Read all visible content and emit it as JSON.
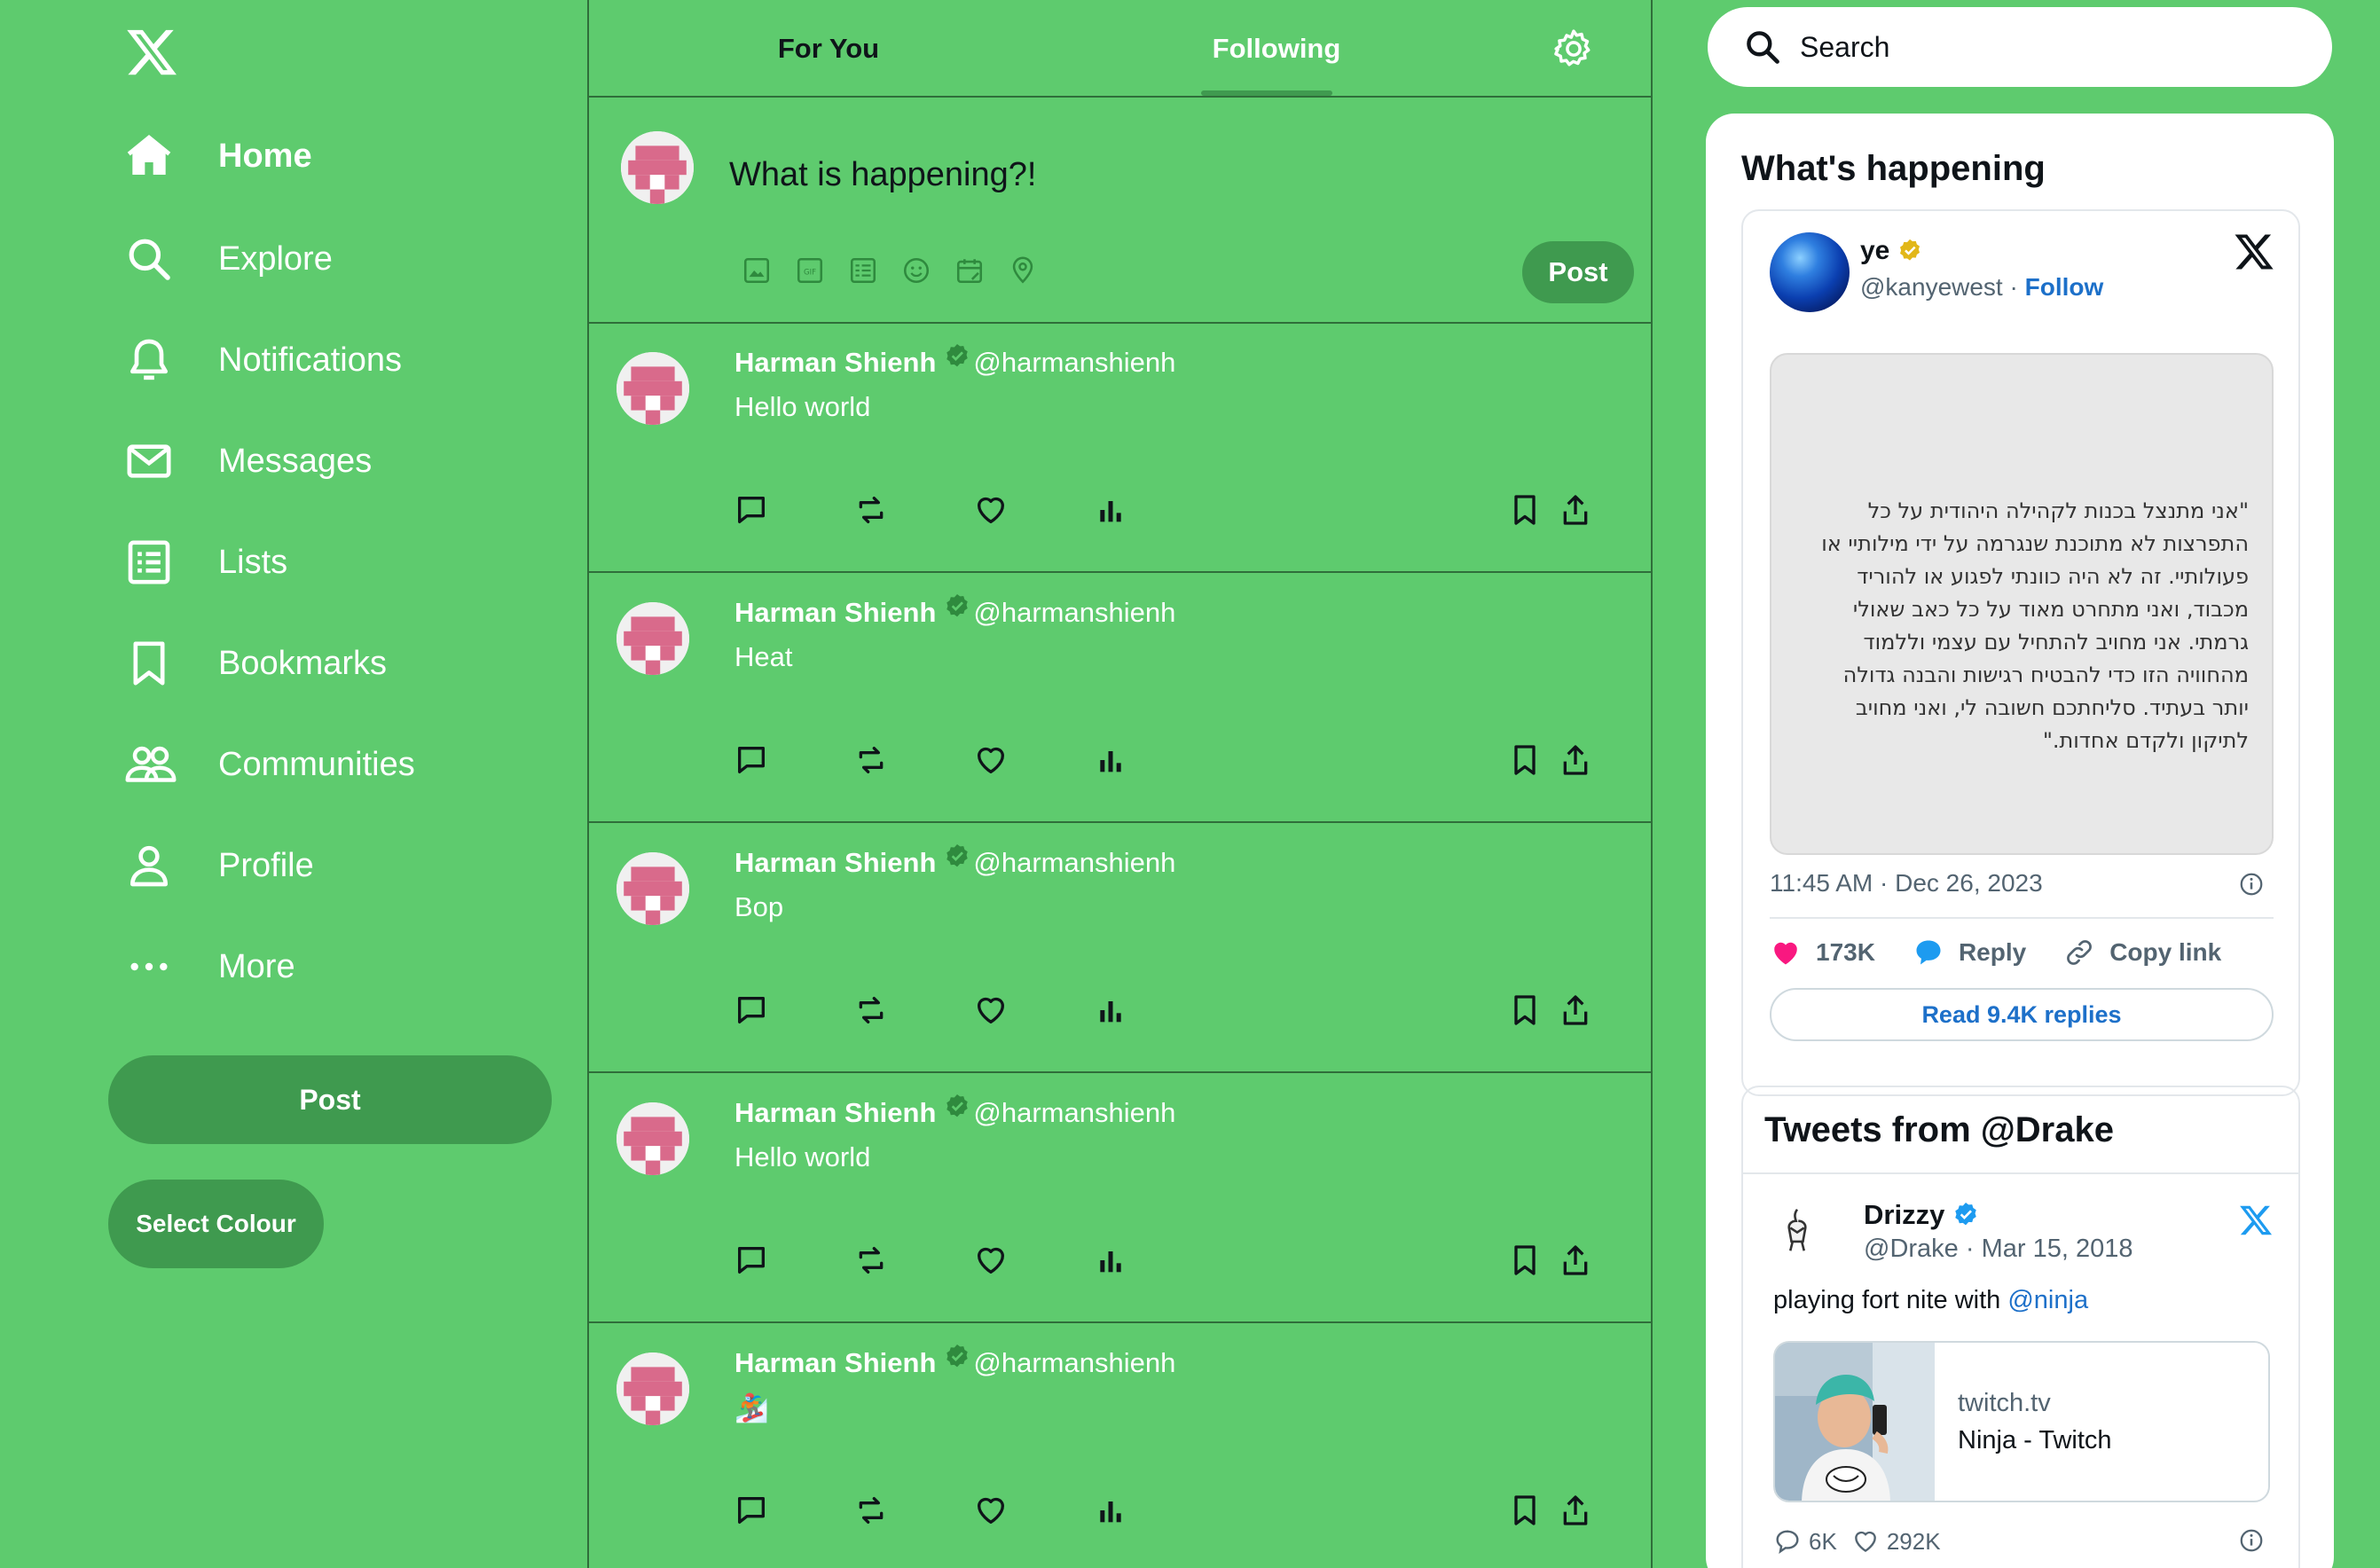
{
  "sidebar": {
    "logo": "x-logo",
    "items": [
      {
        "label": "Home",
        "icon": "home-icon",
        "active": true
      },
      {
        "label": "Explore",
        "icon": "search-icon"
      },
      {
        "label": "Notifications",
        "icon": "bell-icon"
      },
      {
        "label": "Messages",
        "icon": "envelope-icon"
      },
      {
        "label": "Lists",
        "icon": "list-icon"
      },
      {
        "label": "Bookmarks",
        "icon": "bookmark-icon"
      },
      {
        "label": "Communities",
        "icon": "people-icon"
      },
      {
        "label": "Profile",
        "icon": "person-icon"
      },
      {
        "label": "More",
        "icon": "more-icon"
      }
    ],
    "post_label": "Post",
    "select_colour_label": "Select Colour"
  },
  "tabs": [
    {
      "label": "For You",
      "active": false
    },
    {
      "label": "Following",
      "active": true
    }
  ],
  "composer": {
    "placeholder": "What is happening?!",
    "tools": [
      "image-icon",
      "gif-icon",
      "poll-icon",
      "emoji-icon",
      "schedule-icon",
      "location-icon"
    ],
    "post_label": "Post"
  },
  "tweets": [
    {
      "name": "Harman Shienh",
      "handle": "@harmanshienh",
      "text": "Hello world"
    },
    {
      "name": "Harman Shienh",
      "handle": "@harmanshienh",
      "text": "Heat"
    },
    {
      "name": "Harman Shienh",
      "handle": "@harmanshienh",
      "text": "Bop"
    },
    {
      "name": "Harman Shienh",
      "handle": "@harmanshienh",
      "text": "Hello world"
    },
    {
      "name": "Harman Shienh",
      "handle": "@harmanshienh",
      "text": "🏂"
    }
  ],
  "search": {
    "placeholder": "Search"
  },
  "whats_happening": {
    "title": "What's happening",
    "embed": {
      "name": "ye",
      "handle": "@kanyewest",
      "separator": "·",
      "follow_label": "Follow",
      "quote_text": "\"אני מתנצל בכנות לקהילה היהודית על כל התפרצות לא מתוכנת שנגרמה על ידי מילותיי או פעולותיי. זה לא היה כוונתי לפגוע או להוריד מכבוד, ואני מתחרט מאוד על כל כאב שאולי גרמתי. אני מחויב להתחיל עם עצמי וללמוד מהחוויה הזו כדי להבטיח רגישות והבנה גדולה יותר בעתיד. סליחתכם חשובה לי, ואני מחויב לתיקון ולקדם אחדות.\"",
      "timestamp": "11:45 AM · Dec 26, 2023",
      "likes": "173K",
      "reply_label": "Reply",
      "copy_link_label": "Copy link",
      "read_replies_label": "Read 9.4K replies"
    }
  },
  "drake_embed": {
    "title": "Tweets from @Drake",
    "name": "Drizzy",
    "handle_date": "@Drake · Mar 15, 2018",
    "text_prefix": "playing fort nite with ",
    "mention": "@ninja",
    "link_domain": "twitch.tv",
    "link_title": "Ninja - Twitch",
    "replies": "6K",
    "likes": "292K"
  },
  "colors": {
    "background": "#5ecb6e",
    "button": "#3f9a4f",
    "divider": "#2f6e3a",
    "link_blue": "#1d70c9",
    "like_pink": "#f91880"
  }
}
